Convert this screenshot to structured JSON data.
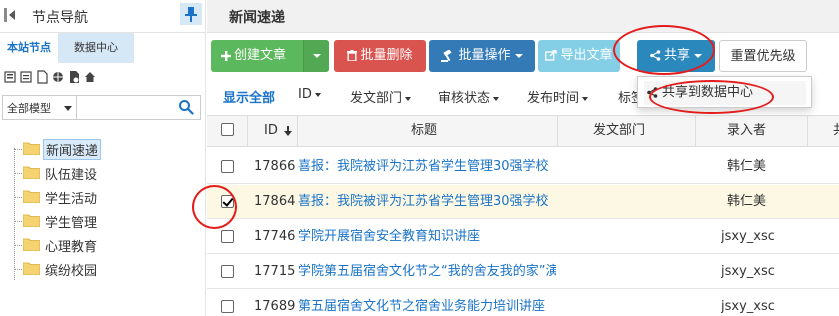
{
  "nav": {
    "title": "节点导航",
    "tabs": [
      "本站节点",
      "数据中心"
    ],
    "tools": [
      "folder-tree-icon",
      "folder-list-icon",
      "file-icon",
      "globe-icon",
      "site-settings-icon",
      "home-icon"
    ],
    "model_select": "全部模型",
    "search_placeholder": "",
    "tree": [
      "新闻速递",
      "队伍建设",
      "学生活动",
      "学生管理",
      "心理教育",
      "缤纷校园"
    ],
    "selected": "新闻速递"
  },
  "page": {
    "title": "新闻速递"
  },
  "toolbar": {
    "create": "创建文章",
    "batch_delete": "批量删除",
    "batch_ops": "批量操作",
    "export": "导出文章",
    "share": "共享",
    "reset_priority": "重置优先级"
  },
  "share_menu": {
    "item": "共享到数据中心"
  },
  "filters": {
    "show_all": "显示全部",
    "id": "ID",
    "dept": "发文部门",
    "review": "审核状态",
    "publish_time": "发布时间",
    "tags": "标签"
  },
  "table": {
    "columns": {
      "id": "ID",
      "title": "标题",
      "dept": "发文部门",
      "author": "录入者",
      "more": "共"
    },
    "rows": [
      {
        "id": "17866",
        "title": "喜报：我院被评为江苏省学生管理30强学校",
        "author": "韩仁美",
        "checked": false
      },
      {
        "id": "17864",
        "title": "喜报：我院被评为江苏省学生管理30强学校",
        "author": "韩仁美",
        "checked": true
      },
      {
        "id": "17746",
        "title": "学院开展宿舍安全教育知识讲座",
        "author": "jsxy_xsc",
        "checked": false
      },
      {
        "id": "17715",
        "title": "学院第五届宿舍文化节之“我的舍友我的家”演",
        "author": "jsxy_xsc",
        "checked": false
      },
      {
        "id": "17689",
        "title": "第五届宿舍文化节之宿舍业务能力培训讲座",
        "author": "jsxy_xsc",
        "checked": false
      }
    ]
  },
  "colors": {
    "create": "#5cb85c",
    "delete": "#d9534f",
    "batch": "#337ab7",
    "export": "#5bc0de",
    "share": "#2a88bd",
    "link": "#1a73c8",
    "annotation": "#e31c1c",
    "selected_row": "#fcf8e3"
  }
}
